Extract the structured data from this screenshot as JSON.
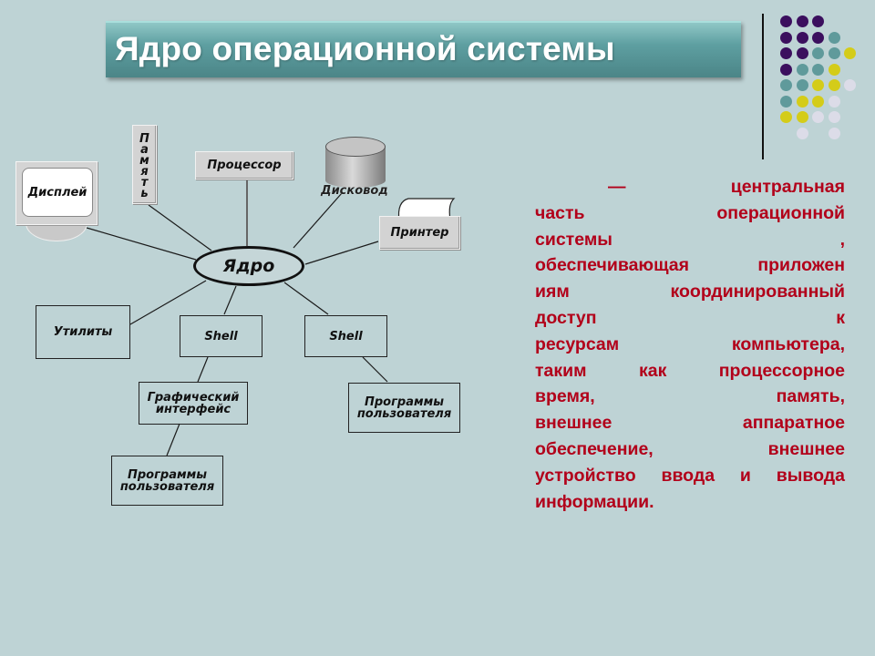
{
  "slide": {
    "title": "Ядро операционной системы",
    "background_color": "#bed3d5",
    "title_bar_color": "#5e9fa1"
  },
  "decoration": {
    "dots": [
      [
        "#3b0f5e",
        "#3b0f5e",
        "#3b0f5e",
        null,
        null
      ],
      [
        "#3b0f5e",
        "#3b0f5e",
        "#3b0f5e",
        "#5f9a9b",
        null
      ],
      [
        "#3b0f5e",
        "#3b0f5e",
        "#5f9a9b",
        "#5f9a9b",
        "#d4cc19"
      ],
      [
        "#3b0f5e",
        "#5f9a9b",
        "#5f9a9b",
        "#d4cc19",
        null
      ],
      [
        "#5f9a9b",
        "#5f9a9b",
        "#d4cc19",
        "#d4cc19",
        "#dcdce8"
      ],
      [
        "#5f9a9b",
        "#d4cc19",
        "#d4cc19",
        "#dcdce8",
        null
      ],
      [
        "#d4cc19",
        "#d4cc19",
        "#dcdce8",
        "#dcdce8",
        null
      ],
      [
        null,
        "#dcdce8",
        null,
        "#dcdce8",
        null
      ]
    ]
  },
  "diagram": {
    "center": "Ядро",
    "nodes": {
      "display": "Дисплей",
      "memory": "Память",
      "processor": "Процессор",
      "disk": "Дисковод",
      "printer": "Принтер",
      "utilities": "Утилиты",
      "shell_left": "Shell",
      "shell_right": "Shell",
      "gui_line1": "Графический",
      "gui_line2": "интерфейс",
      "user_programs_left_line1": "Программы",
      "user_programs_left_line2": "пользователя",
      "user_programs_right_line1": "Программы",
      "user_programs_right_line2": "пользователя"
    }
  },
  "description": {
    "color": "#b2001a",
    "lines": [
      [
        "—",
        "центральная"
      ],
      [
        "часть",
        "операционной"
      ],
      [
        "системы",
        ","
      ],
      [
        "обеспечивающая",
        "приложен"
      ],
      [
        "иям",
        "координированный"
      ],
      [
        "доступ",
        "к"
      ],
      [
        "ресурсам",
        "компьютера,"
      ],
      [
        "таким",
        "как",
        "процессорное"
      ],
      [
        "время,",
        "память,"
      ],
      [
        "внешнее",
        "аппаратное"
      ],
      [
        "обеспечение,",
        "внешнее"
      ],
      [
        "устройство",
        "ввода",
        "и",
        "вывода"
      ],
      [
        "информации."
      ]
    ]
  }
}
